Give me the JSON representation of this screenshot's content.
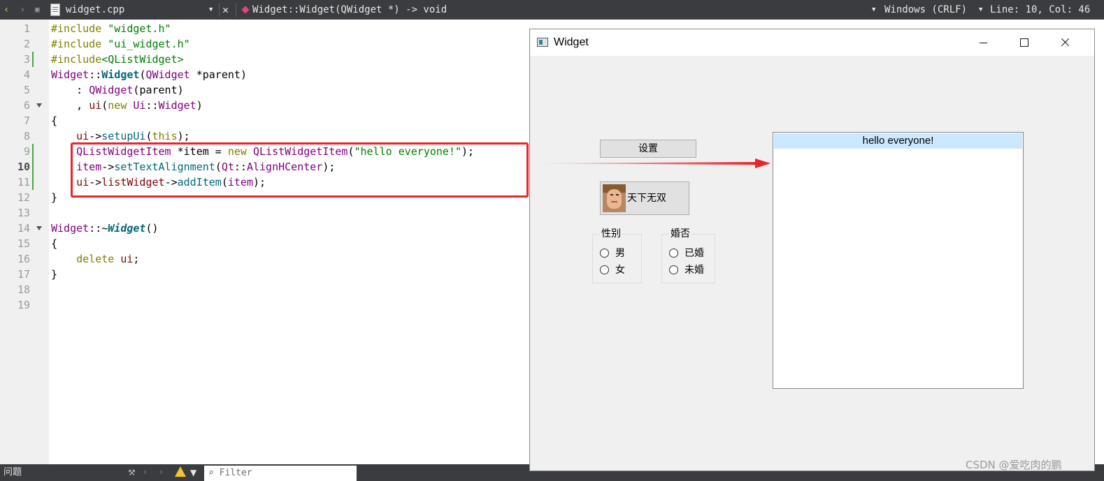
{
  "editor": {
    "file_name": "widget.cpp",
    "function_selector": "Widget::Widget(QWidget *) -> void",
    "encoding": "Windows (CRLF)",
    "cursor_position": "Line: 10, Col: 46",
    "line_numbers": [
      "1",
      "2",
      "3",
      "4",
      "5",
      "6",
      "7",
      "8",
      "9",
      "10",
      "11",
      "12",
      "13",
      "14",
      "15",
      "16",
      "17",
      "18",
      "19"
    ],
    "current_line": 10,
    "code": {
      "l1a": "#include ",
      "l1b": "\"widget.h\"",
      "l2a": "#include ",
      "l2b": "\"ui_widget.h\"",
      "l3a": "#include",
      "l3b": "<QListWidget>",
      "l4a": "Widget",
      "l4b": "::",
      "l4c": "Widget",
      "l4d": "(",
      "l4e": "QWidget",
      "l4f": " *",
      "l4g": "parent",
      "l4h": ")",
      "l5a": "    : ",
      "l5b": "QWidget",
      "l5c": "(",
      "l5d": "parent",
      "l5e": ")",
      "l6a": "    , ",
      "l6b": "ui",
      "l6c": "(",
      "l6d": "new",
      "l6e": " ",
      "l6f": "Ui",
      "l6g": "::",
      "l6h": "Widget",
      "l6i": ")",
      "l7": "{",
      "l8a": "    ",
      "l8b": "ui",
      "l8c": "->",
      "l8d": "setupUi",
      "l8e": "(",
      "l8f": "this",
      "l8g": ");",
      "l9a": "    ",
      "l9b": "QListWidgetItem",
      "l9c": " *",
      "l9d": "item",
      "l9e": " = ",
      "l9f": "new",
      "l9g": " ",
      "l9h": "QListWidgetItem",
      "l9i": "(",
      "l9j": "\"hello everyone!\"",
      "l9k": ");",
      "l10a": "    ",
      "l10b": "item",
      "l10c": "->",
      "l10d": "setTextAlignment",
      "l10e": "(",
      "l10f": "Qt",
      "l10g": "::",
      "l10h": "AlignHCenter",
      "l10i": ");",
      "l11a": "    ",
      "l11b": "ui",
      "l11c": "->",
      "l11d": "listWidget",
      "l11e": "->",
      "l11f": "addItem",
      "l11g": "(",
      "l11h": "item",
      "l11i": ");",
      "l12": "}",
      "l14a": "Widget",
      "l14b": "::~",
      "l14c": "Widget",
      "l14d": "()",
      "l15": "{",
      "l16a": "    ",
      "l16b": "delete",
      "l16c": " ",
      "l16d": "ui",
      "l16e": ";",
      "l17": "}"
    }
  },
  "bottom": {
    "problems_label": "问题",
    "filter_placeholder": "Filter"
  },
  "widget_window": {
    "title": "Widget",
    "set_button": "设置",
    "image_button_label": "天下无双",
    "gender_group": {
      "title": "性别",
      "options": [
        "男",
        "女"
      ]
    },
    "marriage_group": {
      "title": "婚否",
      "options": [
        "已婚",
        "未婚"
      ]
    },
    "list_items": [
      "hello everyone!"
    ],
    "selected_item_color": "#cce8ff"
  },
  "annotation": {
    "color": "#e8242c"
  },
  "watermark": "CSDN @爱吃肉的鹏"
}
